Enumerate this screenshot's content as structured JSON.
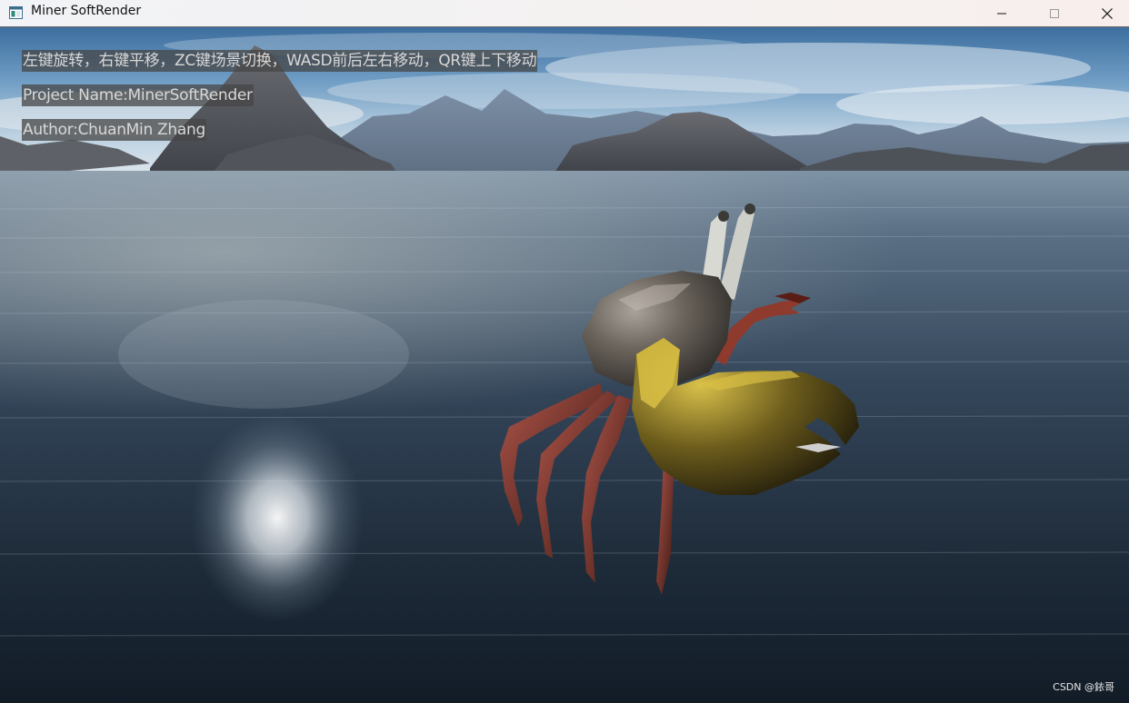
{
  "window": {
    "title": "Miner SoftRender",
    "app_icon": "app-window-icon",
    "controls": {
      "minimize_icon": "minimize-icon",
      "maximize_icon": "maximize-icon",
      "close_icon": "close-icon"
    }
  },
  "overlay": {
    "instructions": "左键旋转，右键平移，ZC键场景切换，WASD前后左右移动，QR键上下移动",
    "project_name": "Project Name:MinerSoftRender",
    "author": "Author:ChuanMin Zhang"
  },
  "scene": {
    "description_icons": [
      "sky",
      "mountains",
      "water",
      "crab-model"
    ],
    "sky_color": "#4a78a8",
    "water_color": "#1f2c3a",
    "crab_shell_color": "#5a544d",
    "crab_claw_color": "#c9b13a",
    "crab_leg_color": "#8a3a2e"
  },
  "watermark": {
    "text": "CSDN @銥哥"
  }
}
